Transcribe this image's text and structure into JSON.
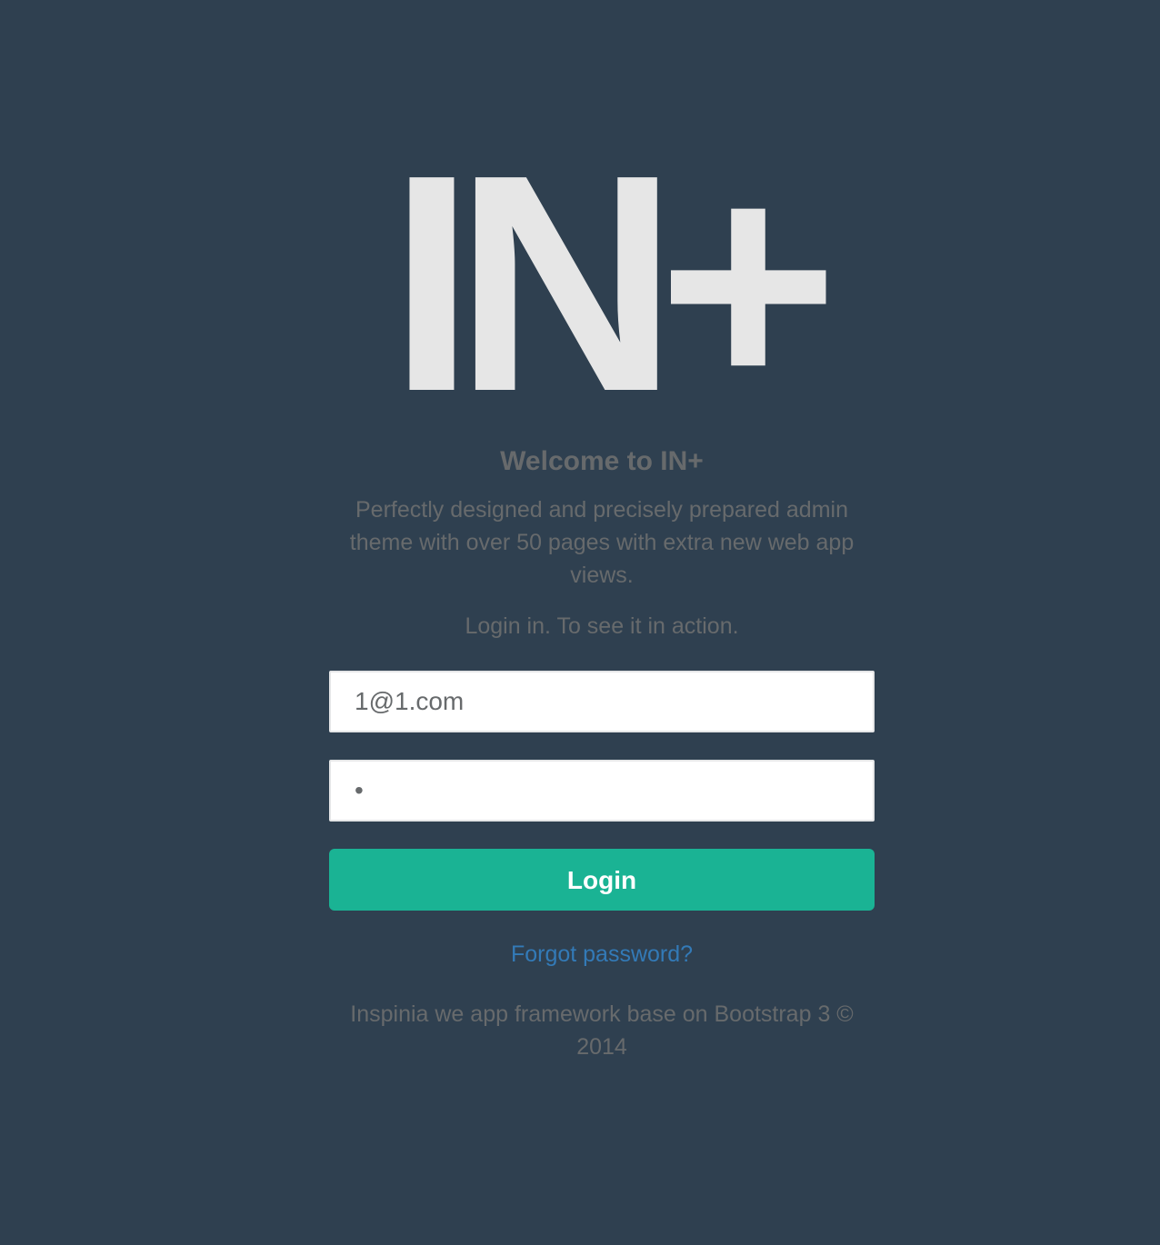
{
  "logo": {
    "text": "IN+"
  },
  "welcome": {
    "title": "Welcome to IN+",
    "description": "Perfectly designed and precisely prepared admin theme with over 50 pages with extra new web app views.",
    "tagline": "Login in. To see it in action."
  },
  "form": {
    "email_value": "1@1.com",
    "password_value": "1",
    "login_label": "Login",
    "forgot_label": "Forgot password?"
  },
  "footer": {
    "line1": "Inspinia we app framework base on Bootstrap 3 ©",
    "line2": "2014"
  },
  "colors": {
    "background": "#2f4050",
    "logo": "#e6e6e6",
    "text": "#676a6c",
    "primary_button": "#1ab394",
    "link": "#337ab7"
  }
}
